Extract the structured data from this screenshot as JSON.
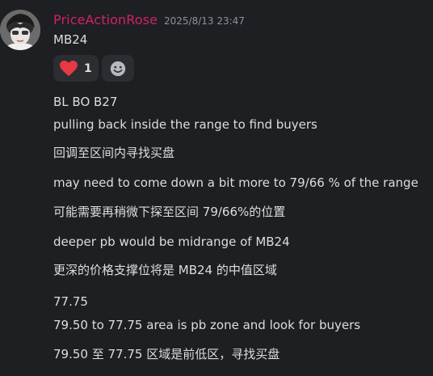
{
  "message": {
    "username": "PriceActionRose",
    "timestamp": "2025/8/13 23:47",
    "title_line": "MB24",
    "reactions": [
      {
        "icon": "heart-icon",
        "count": "1",
        "color": "#e63946"
      }
    ],
    "add_reaction_icon": "smiley-add-reaction-icon",
    "lines": [
      "BL BO  B27",
      "pulling back inside the range to find buyers",
      "回调至区间内寻找买盘",
      "may need to come down a bit more to 79/66 % of the range",
      "可能需要再稍微下探至区间 79/66%的位置",
      "deeper pb would be midrange of MB24",
      "更深的价格支撑位将是 MB24 的中值区域",
      "77.75",
      "79.50 to 77.75 area is pb zone and look for buyers",
      "79.50 至 77.75 区域是前低区，寻找买盘"
    ]
  },
  "colors": {
    "background": "#1e1f22",
    "username": "#d1226a",
    "timestamp": "#8d9198",
    "text": "#dbdee1",
    "reaction_bg": "#2b2d31"
  }
}
